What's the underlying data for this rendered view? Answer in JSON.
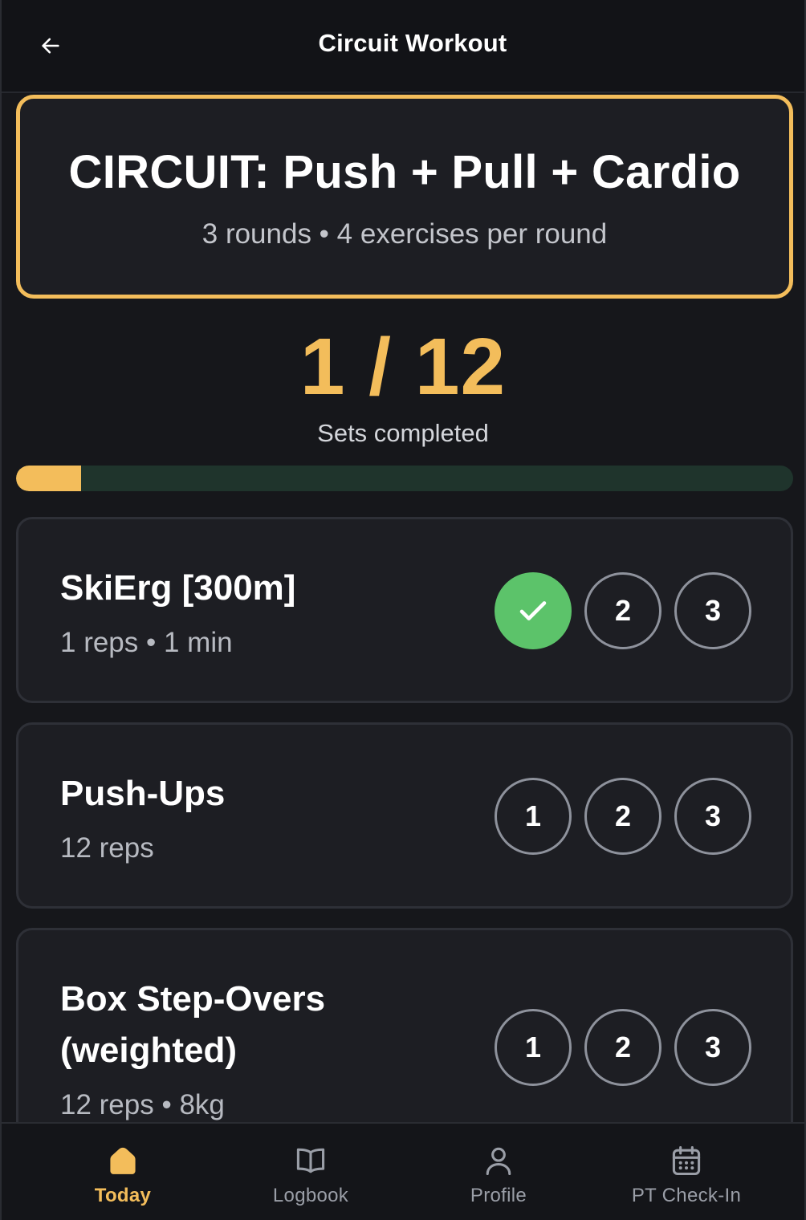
{
  "header": {
    "title": "Circuit Workout",
    "back_icon": "arrow-left-icon"
  },
  "circuit": {
    "title": "CIRCUIT: Push + Pull + Cardio",
    "subtitle": "3 rounds • 4 exercises per round"
  },
  "progress": {
    "count": "1 / 12",
    "label": "Sets completed",
    "completed": 1,
    "total": 12
  },
  "exercises": [
    {
      "name": "SkiErg [300m]",
      "meta": "1 reps • 1 min",
      "sets": [
        {
          "label": "1",
          "done": true
        },
        {
          "label": "2",
          "done": false
        },
        {
          "label": "3",
          "done": false
        }
      ]
    },
    {
      "name": "Push-Ups",
      "meta": "12 reps",
      "sets": [
        {
          "label": "1",
          "done": false
        },
        {
          "label": "2",
          "done": false
        },
        {
          "label": "3",
          "done": false
        }
      ]
    },
    {
      "name_line1": "Box Step-Overs",
      "name_line2": "(weighted)",
      "meta": "12 reps • 8kg",
      "sets": [
        {
          "label": "1",
          "done": false
        },
        {
          "label": "2",
          "done": false
        },
        {
          "label": "3",
          "done": false
        }
      ]
    }
  ],
  "nav": {
    "items": [
      {
        "label": "Today",
        "icon": "home-icon",
        "active": true
      },
      {
        "label": "Logbook",
        "icon": "book-icon",
        "active": false
      },
      {
        "label": "Profile",
        "icon": "user-icon",
        "active": false
      },
      {
        "label": "PT Check-In",
        "icon": "calendar-icon",
        "active": false
      }
    ]
  },
  "colors": {
    "accent": "#f3bd5b",
    "done": "#5cc36a",
    "progress_track": "#1f342c",
    "background": "#16171b"
  }
}
